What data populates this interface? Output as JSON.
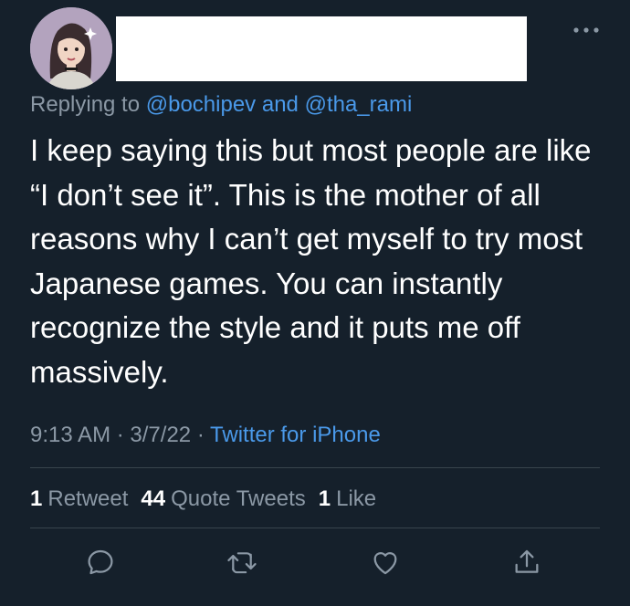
{
  "header": {
    "avatar_icon": "user-avatar-illustration",
    "more_icon": "ellipsis-icon"
  },
  "reply": {
    "prefix": "Replying to",
    "mention1": "@bochipev",
    "conjunction": "and",
    "mention2": "@tha_rami"
  },
  "tweet": {
    "text": "I keep saying this but most people are like “I don’t see it”. This is the mother of all reasons why I can’t get myself to try most Japanese games. You can instantly recognize the style and it puts me off massively."
  },
  "meta": {
    "time": "9:13 AM",
    "sep1": "·",
    "date": "3/7/22",
    "sep2": "·",
    "source": "Twitter for iPhone"
  },
  "stats": {
    "retweets_count": "1",
    "retweets_label": "Retweet",
    "quotes_count": "44",
    "quotes_label": "Quote Tweets",
    "likes_count": "1",
    "likes_label": "Like"
  },
  "actions": {
    "reply_icon": "reply-icon",
    "retweet_icon": "retweet-icon",
    "like_icon": "heart-icon",
    "share_icon": "share-icon"
  },
  "colors": {
    "background": "#15202b",
    "text": "#ffffff",
    "secondary": "#8b98a5",
    "accent": "#4a99e9",
    "divider": "#38444d"
  }
}
